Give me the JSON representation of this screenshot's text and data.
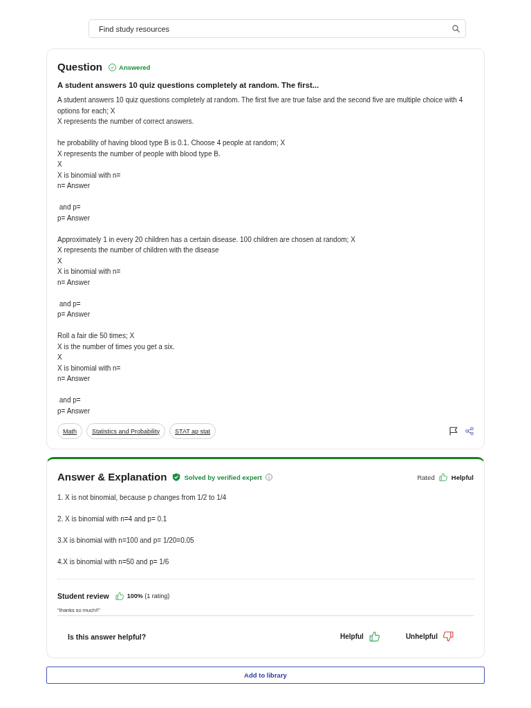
{
  "search": {
    "placeholder": "Find study resources"
  },
  "question": {
    "heading": "Question",
    "status": "Answered",
    "title": "A student answers 10 quiz questions completely at random. The first...",
    "body": [
      [
        "A student answers 10 quiz questions completely at random. The first five are true false and the second five are multiple choice with 4 options for each; X",
        "X represents the number of correct answers."
      ],
      [
        "he probability of having blood type B is 0.1. Choose 4 people at random; X",
        "X represents the number of people with blood type B.",
        "X",
        "X is binomial with n=",
        "n= Answer"
      ],
      [
        " and p=",
        "p= Answer"
      ],
      [
        "Approximately 1 in every 20 children has a certain disease. 100 children are chosen at random; X",
        "X represents the number of children with the disease",
        "X",
        "X is binomial with n=",
        "n= Answer"
      ],
      [
        " and p=",
        "p= Answer"
      ],
      [
        "Roll a fair die 50 times; X",
        "X is the number of times you get a six.",
        "X",
        "X is binomial with n=",
        "n= Answer"
      ],
      [
        " and p=",
        "p= Answer"
      ]
    ],
    "tags": [
      "Math",
      "Statistics and Probability",
      "STAT ap stat"
    ]
  },
  "answer": {
    "heading": "Answer & Explanation",
    "badge": "Solved by verified expert",
    "rated_label": "Rated",
    "rating": "Helpful",
    "paragraphs": [
      "1. X is not binomial, because p changes from 1/2 to 1/4",
      "2. X is binomial with n=4 and p= 0.1",
      "3.X is binomial with n=100 and p= 1/20=0.05",
      "4.X is binomial with n=50 and p= 1/6"
    ],
    "review": {
      "label": "Student review",
      "score": "**100%** (1 rating)",
      "quote": "\"thanks so much!!\""
    },
    "feedback": {
      "question": "Is this answer helpful?",
      "helpful": "Helpful",
      "unhelpful": "Unhelpful"
    }
  },
  "add_button": "Add to library"
}
